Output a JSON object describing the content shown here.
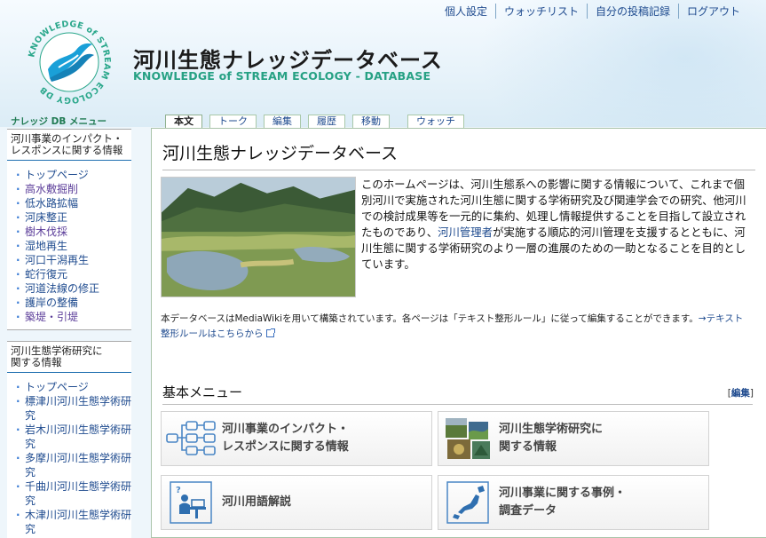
{
  "personal": {
    "settings": "個人設定",
    "watchlist": "ウォッチリスト",
    "contributions": "自分の投稿記録",
    "logout": "ログアウト"
  },
  "site": {
    "title": "河川生態ナレッジデータベース",
    "subtitle": "KNOWLEDGE of STREAM ECOLOGY - DATABASE",
    "logo_text": "KNOWLEDGE of STREAM ECOLOGY DB"
  },
  "tabs": [
    "本文",
    "トーク",
    "編集",
    "履歴",
    "移動",
    "ウォッチ"
  ],
  "sidebar": {
    "title": "ナレッジ DB メニュー",
    "portlets": [
      {
        "head": "河川事業のインパクト・\nレスポンスに関する情報",
        "items": [
          "トップページ",
          "高水敷掘削",
          "低水路拡幅",
          "河床整正",
          "樹木伐採",
          "湿地再生",
          "河口干潟再生",
          "蛇行復元",
          "河道法線の修正",
          "護岸の整備",
          "築堤・引堤"
        ]
      },
      {
        "head": "河川生態学術研究に\n関する情報",
        "items": [
          "トップページ",
          "標津川河川生態学術研究",
          "岩木川河川生態学術研究",
          "多摩川河川生態学術研究",
          "千曲川河川生態学術研究",
          "木津川河川生態学術研究"
        ]
      }
    ]
  },
  "content": {
    "heading": "河川生態ナレッジデータベース",
    "intro_before": "このホームページは、河川生態系への影響に関する情報について、これまで個別河川で実施された河川生態に関する学術研究及び関連学会での研究、他河川での検討成果等を一元的に集約、処理し情報提供することを目指して設立されたものであり、",
    "intro_link": "河川管理者",
    "intro_after": "が実施する順応的河川管理を支援するとともに、河川生態に関する学術研究のより一層の進展のための一助となることを目的としています。",
    "note_text": "本データベースはMediaWikiを用いて構築されています。各ページは「テキスト整形ルール」に従って編集することができます。",
    "note_link": "→テキスト整形ルールはこちらから",
    "menu_heading": "基本メニュー",
    "edit_label": "編集",
    "cards": [
      {
        "label": "河川事業のインパクト・\nレスポンスに関する情報",
        "icon": "flowchart-icon"
      },
      {
        "label": "河川生態学術研究に\n関する情報",
        "icon": "nature-photos-icon"
      },
      {
        "label": "河川用語解説",
        "icon": "person-reading-icon"
      },
      {
        "label": "河川事業に関する事例・\n調査データ",
        "icon": "japan-map-icon"
      }
    ]
  },
  "colors": {
    "link": "#1f4b8f",
    "brand_green": "#27a184",
    "tab_border": "#a9c8a9"
  }
}
